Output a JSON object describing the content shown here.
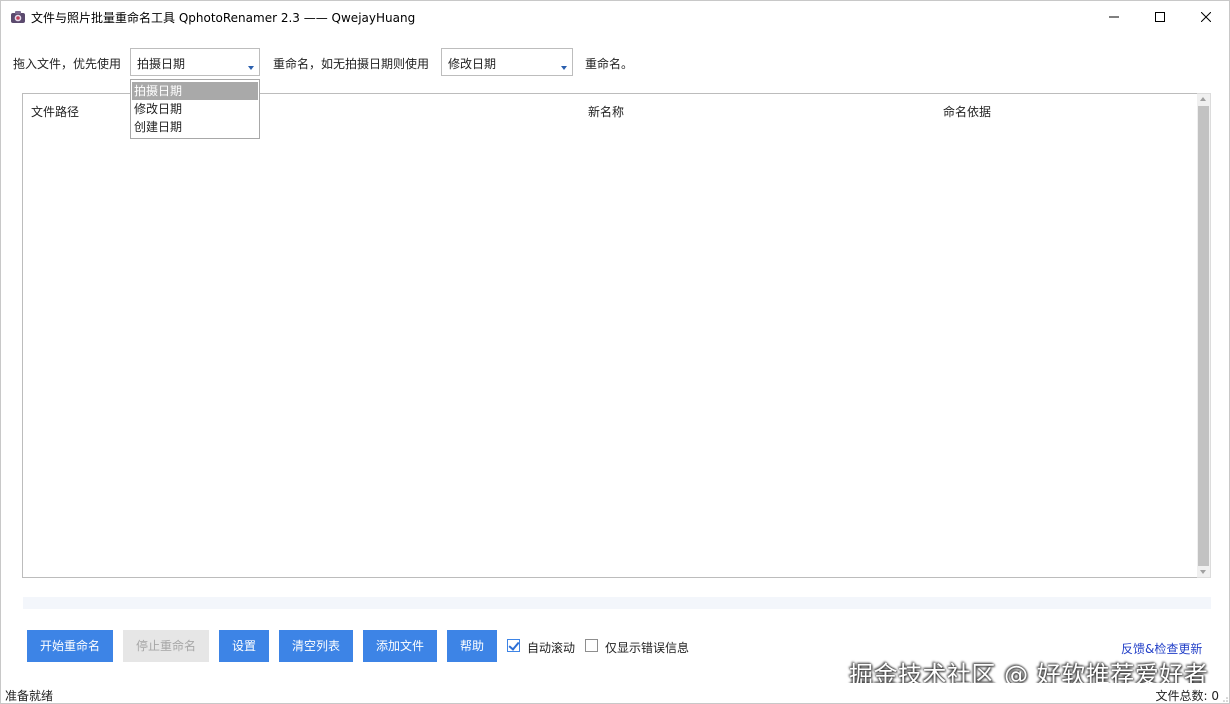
{
  "window": {
    "title": "文件与照片批量重命名工具 QphotoRenamer 2.3 —— QwejayHuang"
  },
  "options": {
    "prefix_label": "拖入文件，优先使用",
    "primary_value": "拍摄日期",
    "middle_label": "重命名，如无拍摄日期则使用",
    "fallback_value": "修改日期",
    "suffix_label": "重命名。",
    "primary_options": [
      "拍摄日期",
      "修改日期",
      "创建日期"
    ],
    "selected_index": 0
  },
  "table": {
    "columns": [
      "文件路径",
      "新名称",
      "命名依据"
    ],
    "rows": []
  },
  "progress": {
    "value": 0
  },
  "buttons": {
    "start": "开始重命名",
    "stop": "停止重命名",
    "settings": "设置",
    "clear": "清空列表",
    "add": "添加文件",
    "help": "帮助"
  },
  "checkboxes": {
    "auto_scroll": {
      "label": "自动滚动",
      "checked": true
    },
    "errors_only": {
      "label": "仅显示错误信息",
      "checked": false
    }
  },
  "feedback_link": "反馈&检查更新",
  "watermark": "掘金技术社区 @ 好软推荐爱好者",
  "status": {
    "message": "准备就绪",
    "file_count": "文件总数: 0"
  },
  "colors": {
    "accent": "#3d84e6",
    "disabled_bg": "#e6e6e6",
    "link": "#2340c8"
  }
}
